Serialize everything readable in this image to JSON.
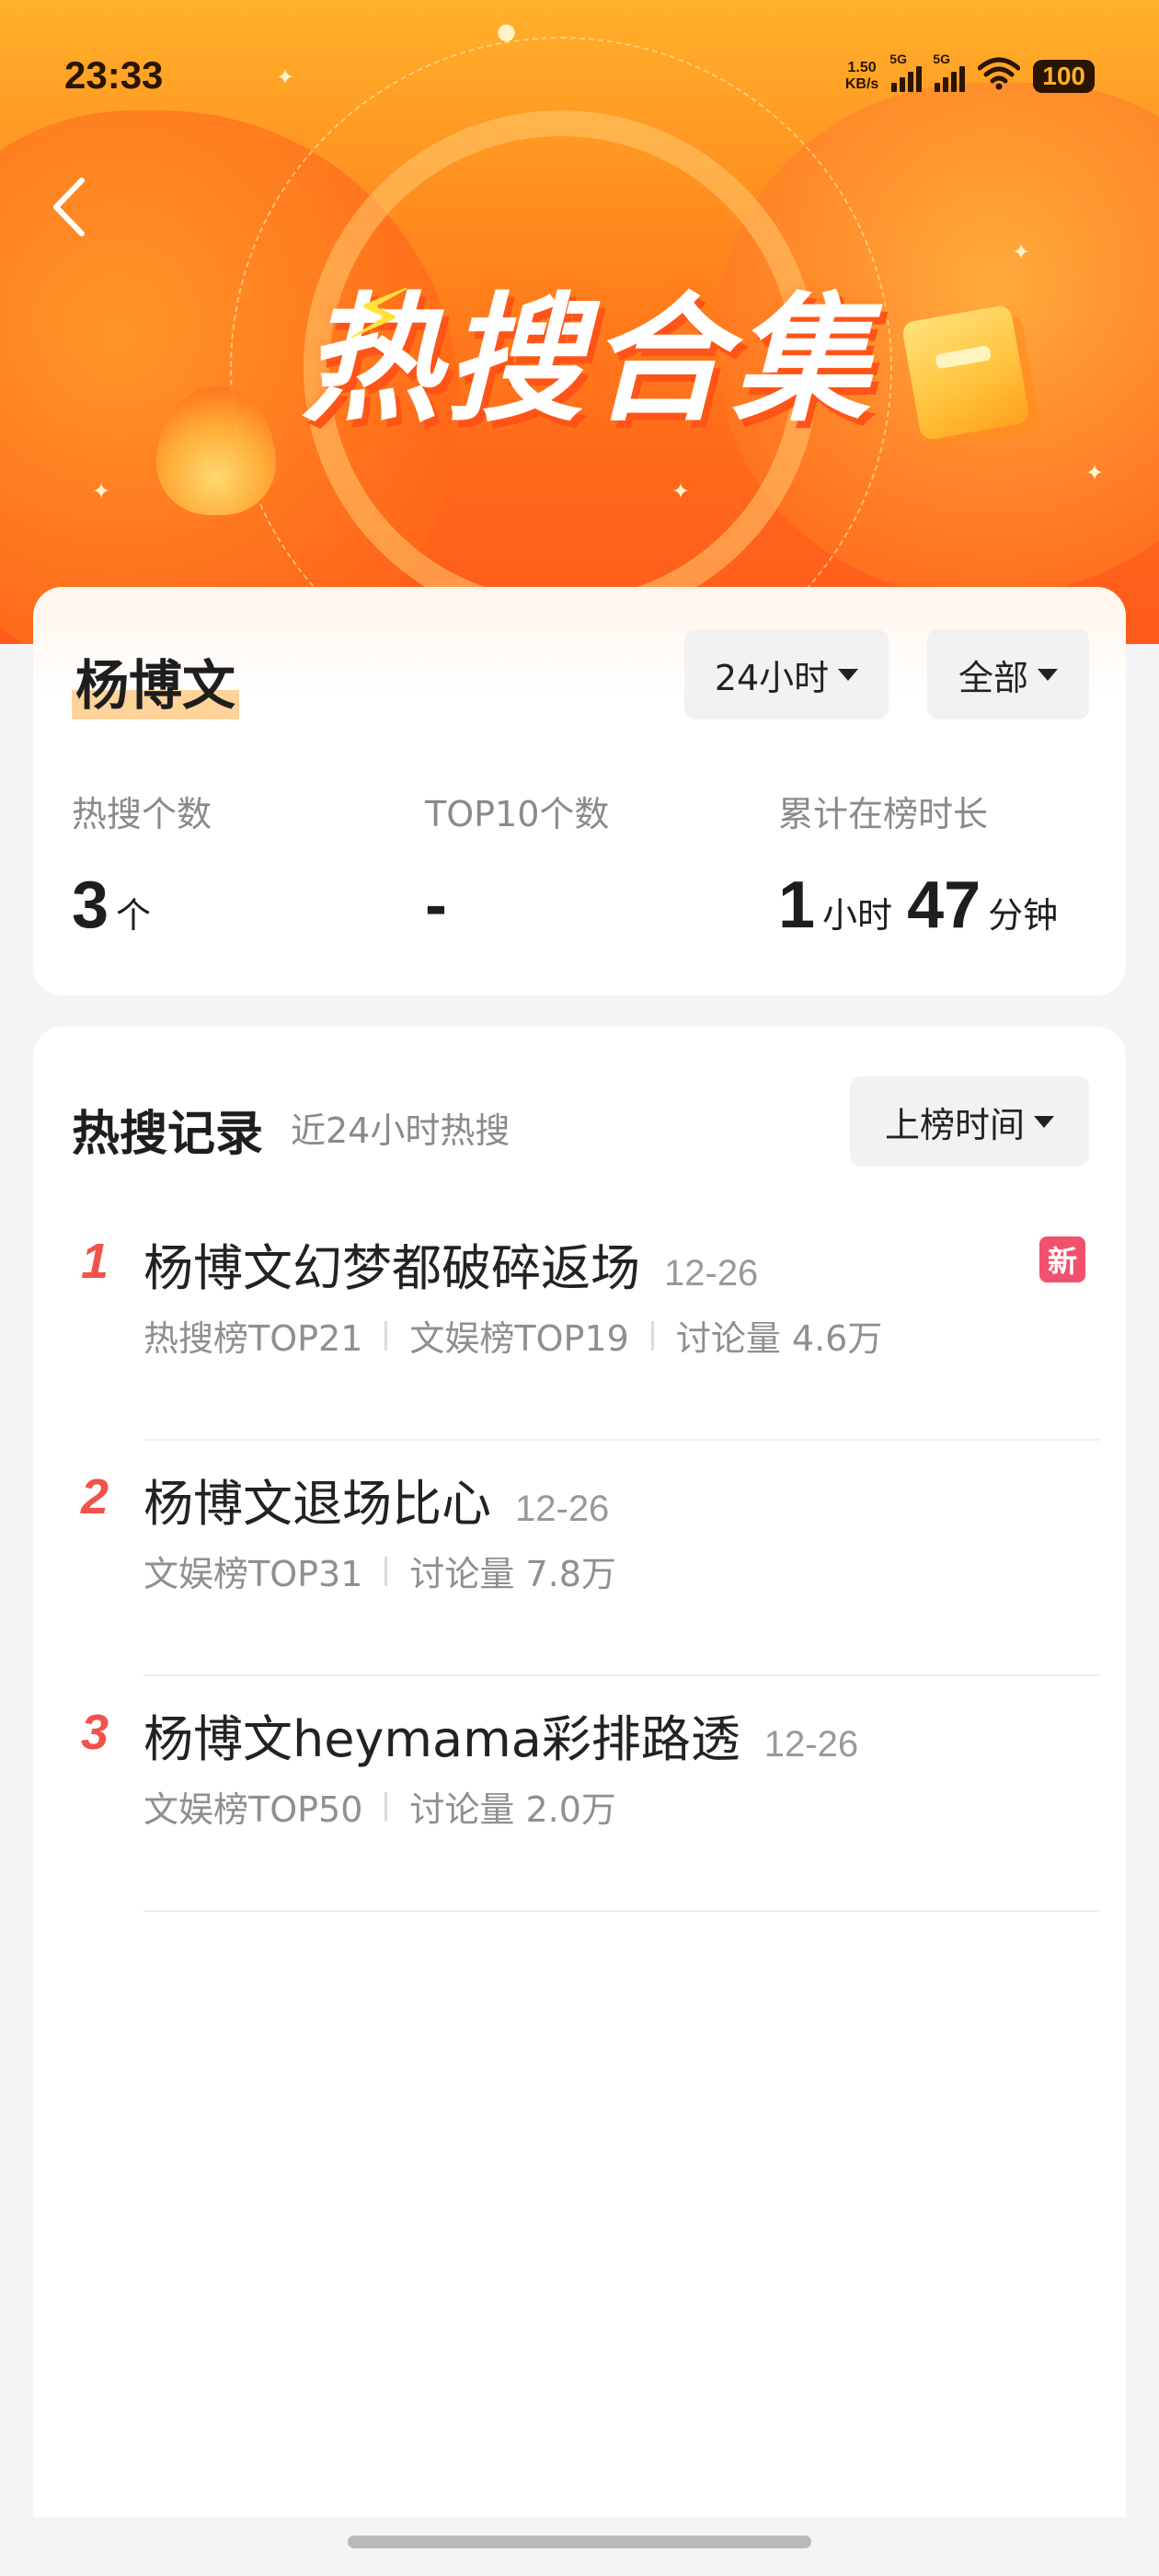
{
  "status_bar": {
    "time": "23:33",
    "net_speed_value": "1.50",
    "net_speed_unit": "KB/s",
    "sim1_tag": "5G",
    "sim2_tag": "5G",
    "battery": "100"
  },
  "banner": {
    "title": "热搜合集"
  },
  "summary": {
    "name": "杨博文",
    "time_filter": "24小时",
    "scope_filter": "全部",
    "stats": [
      {
        "label": "热搜个数",
        "value": "3",
        "unit": "个"
      },
      {
        "label": "TOP10个数",
        "value": "-"
      },
      {
        "label": "累计在榜时长",
        "hours": "1",
        "hours_unit": "小时",
        "minutes": "47",
        "minutes_unit": "分钟"
      }
    ]
  },
  "records": {
    "title": "热搜记录",
    "subtitle": "近24小时热搜",
    "sort_label": "上榜时间",
    "items": [
      {
        "rank": "1",
        "title": "杨博文幻梦都破碎返场",
        "date": "12-26",
        "tags": [
          "热搜榜TOP21",
          "文娱榜TOP19",
          "讨论量 4.6万"
        ],
        "badge": "新"
      },
      {
        "rank": "2",
        "title": "杨博文退场比心",
        "date": "12-26",
        "tags": [
          "文娱榜TOP31",
          "讨论量 7.8万"
        ]
      },
      {
        "rank": "3",
        "title": "杨博文heymama彩排路透",
        "date": "12-26",
        "tags": [
          "文娱榜TOP50",
          "讨论量 2.0万"
        ]
      }
    ]
  },
  "colors": {
    "banner_top": "#ffb12b",
    "banner_bottom": "#ff5a1c",
    "rank_red": "#f0534a",
    "new_badge": "#f0526e",
    "name_highlight": "#ffd39a"
  }
}
